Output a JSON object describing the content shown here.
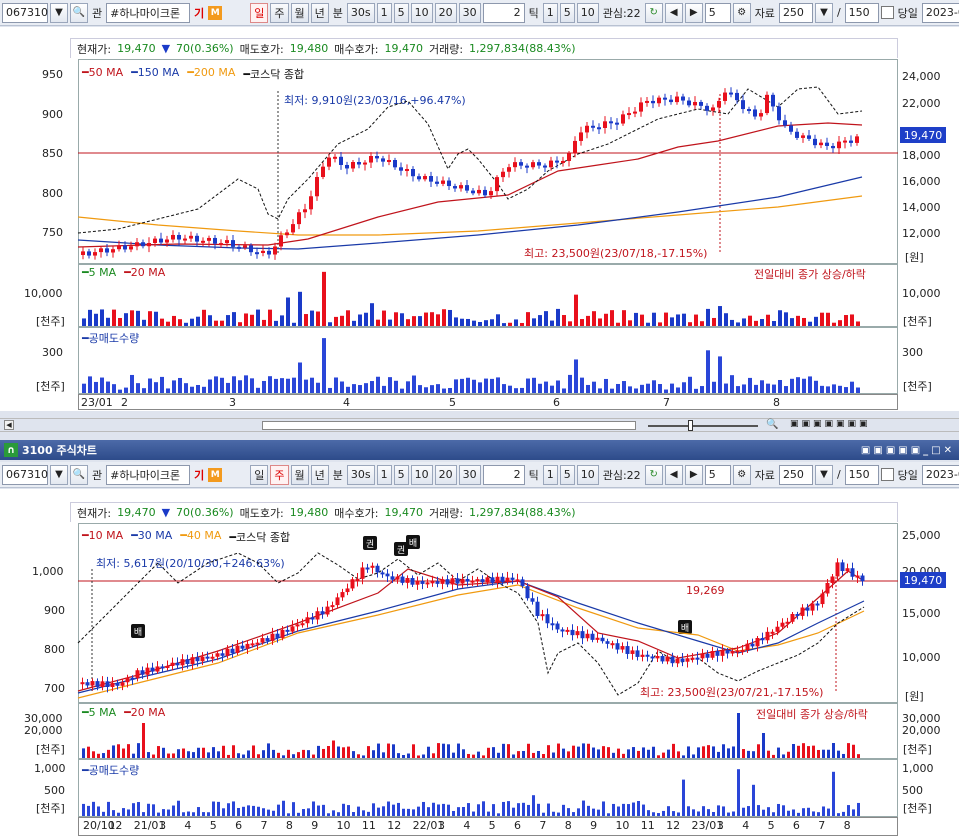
{
  "toolbar": {
    "code": "067310",
    "stock_name": "#하나마이크론",
    "flag_gi": "기",
    "flag_m": "M",
    "periods_top": [
      "일",
      "주",
      "월",
      "년",
      "분",
      "30s"
    ],
    "periods_bottom": [
      "일",
      "주",
      "월",
      "년",
      "분",
      "30s"
    ],
    "intervals": [
      "1",
      "5",
      "10",
      "20",
      "30"
    ],
    "tick_value": "2",
    "tick_label": "틱",
    "tick_intervals": [
      "1",
      "5",
      "10"
    ],
    "interest_label": "관심:22",
    "count_value": "5",
    "data_label": "자료",
    "data_count": "250",
    "slash": "/",
    "total_count": "150",
    "today_label": "당일",
    "date": "2023-08-"
  },
  "top": {
    "info": {
      "price_label": "현재가:",
      "price": "19,470",
      "change": "70(0.36%)",
      "ask_label": "매도호가:",
      "ask": "19,480",
      "bid_label": "매수호가:",
      "bid": "19,470",
      "vol_label": "거래량:",
      "vol": "1,297,834(88.43%)"
    },
    "ma_legend": [
      "50 MA",
      "150 MA",
      "200 MA",
      "코스닥 종합"
    ],
    "left_axis": [
      "950",
      "900",
      "850",
      "800",
      "750"
    ],
    "right_axis": [
      "24,000",
      "22,000",
      "20,000",
      "18,000",
      "16,000",
      "14,000",
      "12,000",
      "[원]"
    ],
    "price_tag": "19,470",
    "low_note": "최저: 9,910원(23/03/16,+96.47%)",
    "high_note": "최고: 23,500원(23/07/18,-17.15%)",
    "vol_legend": [
      "5 MA",
      "20 MA"
    ],
    "vol_note": "전일대비 종가 상승/하락",
    "vol_left": "10,000",
    "vol_right": "10,000",
    "unit": "[천주]",
    "short_legend": "공매도수량",
    "short_left": "300",
    "short_right": "300",
    "x_labels": [
      "23/01",
      "2",
      "3",
      "4",
      "5",
      "6",
      "7",
      "8"
    ]
  },
  "bottom": {
    "title": "3100 주식차트",
    "info": {
      "price_label": "현재가:",
      "price": "19,470",
      "change": "70(0.36%)",
      "ask_label": "매도호가:",
      "ask": "19,480",
      "bid_label": "매수호가:",
      "bid": "19,470",
      "vol_label": "거래량:",
      "vol": "1,297,834(88.43%)"
    },
    "ma_legend": [
      "10 MA",
      "30 MA",
      "40 MA",
      "코스닥 종합"
    ],
    "left_axis": [
      "1,000",
      "900",
      "800",
      "700"
    ],
    "right_axis": [
      "25,000",
      "20,000",
      "15,000",
      "10,000",
      "[원]"
    ],
    "price_tag": "19,470",
    "low_note": "최저: 5,617원(20/10/30,+246.63%)",
    "high_note": "최고: 23,500원(23/07/21,-17.15%)",
    "line_value": "19,269",
    "badges": [
      "배",
      "권",
      "권",
      "배",
      "배"
    ],
    "vol_legend": [
      "5 MA",
      "20 MA"
    ],
    "vol_note": "전일대비 종가 상승/하락",
    "vol_left": [
      "30,000",
      "20,000"
    ],
    "vol_right": [
      "30,000",
      "20,000"
    ],
    "unit": "[천주]",
    "short_legend": "공매도수량",
    "short_left": [
      "1,000",
      "500"
    ],
    "short_right": [
      "1,000",
      "500"
    ],
    "x_labels": [
      "20/10",
      "12",
      "21/01",
      "3",
      "4",
      "5",
      "6",
      "7",
      "8",
      "9",
      "10",
      "11",
      "12",
      "22/01",
      "3",
      "4",
      "5",
      "6",
      "7",
      "8",
      "9",
      "10",
      "11",
      "12",
      "23/01",
      "3",
      "4",
      "5",
      "6",
      "7",
      "8"
    ]
  },
  "colors": {
    "up": "#e8101c",
    "down": "#1a3ac8",
    "ma50": "#c0141c",
    "ma150": "#1a3aa8",
    "ma200": "#f09a10",
    "index": "#111111"
  }
}
